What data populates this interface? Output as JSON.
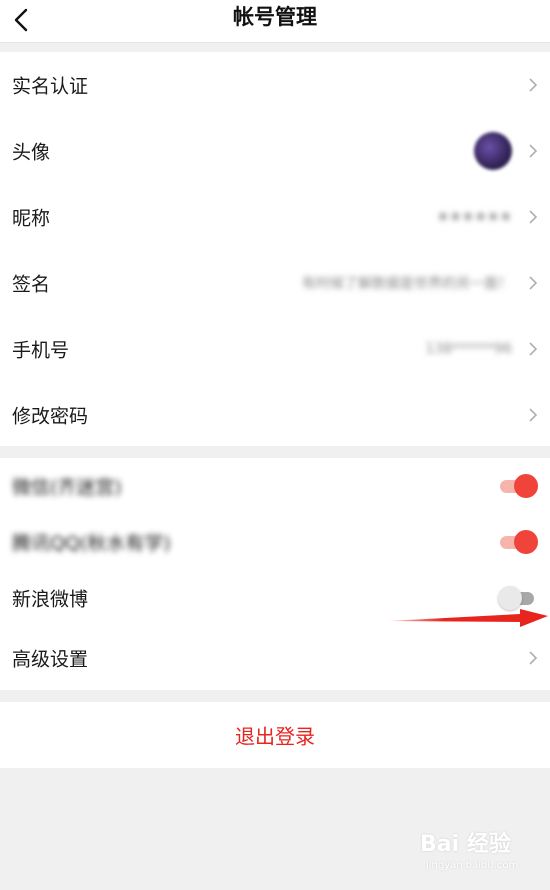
{
  "header": {
    "title": "帐号管理"
  },
  "profile": {
    "items": [
      {
        "label": "实名认证"
      },
      {
        "label": "头像"
      },
      {
        "label": "昵称",
        "value": "★★★★★★"
      },
      {
        "label": "签名",
        "value": "有时候了解数据是世界的另一面！"
      },
      {
        "label": "手机号",
        "value": "138******96"
      },
      {
        "label": "修改密码"
      }
    ]
  },
  "bindings": {
    "items": [
      {
        "label": "微信(齐迷宫)",
        "on": true
      },
      {
        "label": "腾讯QQ(秋水有学)",
        "on": true
      },
      {
        "label": "新浪微博",
        "on": false
      },
      {
        "label": "高级设置"
      }
    ]
  },
  "logout": {
    "label": "退出登录"
  },
  "colors": {
    "accent": "#f0433a",
    "logout": "#e8241e"
  },
  "watermark": {
    "brand": "Bai 经验",
    "url": "jingyan.baidu.com"
  }
}
